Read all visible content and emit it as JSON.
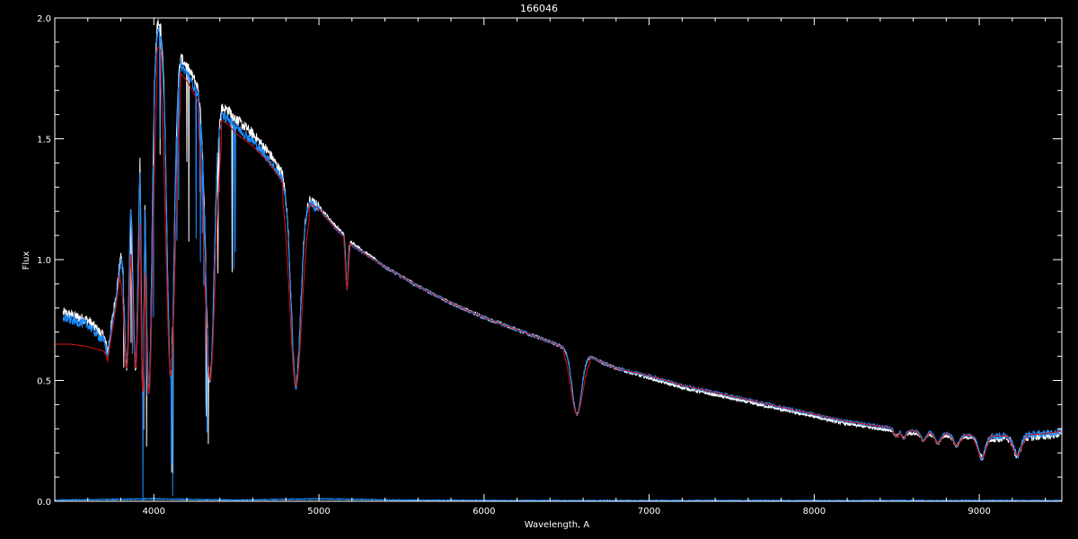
{
  "chart_data": {
    "type": "line",
    "title": "166046",
    "xlabel": "Wavelength, A",
    "ylabel": "Flux",
    "xlim": [
      3400,
      9500
    ],
    "ylim": [
      0,
      2.0
    ],
    "x_ticks": [
      4000,
      5000,
      6000,
      7000,
      8000,
      9000
    ],
    "x_tick_labels": [
      "4000",
      "5000",
      "6000",
      "7000",
      "8000",
      "9000"
    ],
    "y_ticks": [
      0.0,
      0.5,
      1.0,
      1.5,
      2.0
    ],
    "y_tick_labels": [
      "0.0",
      "0.5",
      "1.0",
      "1.5",
      "2.0"
    ],
    "grid": false,
    "background": "#000000",
    "foreground": "#ffffff",
    "series": [
      {
        "color": "#ffffff",
        "style": "observed-white",
        "x": [
          3450,
          3600,
          3700,
          3720,
          3780,
          3850,
          3900,
          3950,
          4000,
          4030,
          4080,
          4150,
          4200,
          4250,
          4300,
          4400,
          4450,
          4500,
          4600,
          4700,
          4800,
          4850,
          4900,
          5000,
          5100,
          5200,
          5400,
          5600,
          5800,
          6000,
          6200,
          6400,
          6500,
          6600,
          6700,
          6800,
          7000,
          7200,
          7400,
          7600,
          7800,
          8000,
          8200,
          8400,
          8600,
          8800,
          9000,
          9200,
          9400,
          9500
        ],
        "y": [
          0.78,
          0.75,
          0.68,
          0.62,
          0.9,
          1.35,
          1.62,
          1.78,
          1.95,
          1.98,
          1.88,
          1.85,
          1.8,
          1.74,
          1.65,
          1.63,
          1.62,
          1.58,
          1.52,
          1.44,
          1.33,
          1.28,
          1.26,
          1.22,
          1.14,
          1.07,
          0.97,
          0.89,
          0.82,
          0.76,
          0.71,
          0.66,
          0.63,
          0.61,
          0.58,
          0.55,
          0.51,
          0.47,
          0.44,
          0.41,
          0.38,
          0.35,
          0.32,
          0.3,
          0.28,
          0.27,
          0.26,
          0.26,
          0.27,
          0.28
        ]
      },
      {
        "color": "#1a8cff",
        "style": "observed-blue",
        "x": [
          3450,
          3600,
          3700,
          3720,
          3780,
          3850,
          3900,
          3950,
          4000,
          4030,
          4080,
          4150,
          4200,
          4250,
          4300,
          4400,
          4450,
          4500,
          4600,
          4700,
          4800,
          4850,
          4900,
          5000,
          5100,
          5200,
          5400,
          5600,
          5800,
          6000,
          6200,
          6400,
          6500,
          6600,
          6700,
          6800,
          7000,
          7200,
          7400,
          7600,
          7800,
          8000,
          8200,
          8400,
          8600,
          8800,
          9000,
          9200,
          9400,
          9500
        ],
        "y": [
          0.76,
          0.73,
          0.66,
          0.6,
          0.88,
          1.32,
          1.58,
          1.74,
          1.9,
          1.95,
          1.85,
          1.82,
          1.77,
          1.71,
          1.62,
          1.6,
          1.58,
          1.55,
          1.49,
          1.41,
          1.31,
          1.27,
          1.25,
          1.21,
          1.13,
          1.06,
          0.97,
          0.89,
          0.82,
          0.76,
          0.71,
          0.66,
          0.63,
          0.61,
          0.58,
          0.55,
          0.52,
          0.48,
          0.45,
          0.42,
          0.39,
          0.36,
          0.33,
          0.31,
          0.29,
          0.28,
          0.27,
          0.27,
          0.28,
          0.29
        ]
      },
      {
        "color": "#cc1111",
        "style": "model-red",
        "x": [
          3400,
          3500,
          3600,
          3700,
          3720,
          3780,
          3850,
          3900,
          3950,
          4000,
          4030,
          4080,
          4150,
          4200,
          4250,
          4300,
          4400,
          4450,
          4500,
          4600,
          4700,
          4800,
          4850,
          4900,
          5000,
          5100,
          5200,
          5400,
          5600,
          5800,
          6000,
          6200,
          6400,
          6500,
          6600,
          6700,
          6800,
          7000,
          7200,
          7400,
          7600,
          7800,
          8000,
          8200,
          8400,
          8600,
          8800,
          9000,
          9200,
          9400,
          9500
        ],
        "y": [
          0.65,
          0.65,
          0.64,
          0.62,
          0.58,
          0.85,
          1.28,
          1.55,
          1.7,
          1.85,
          1.88,
          1.8,
          1.78,
          1.74,
          1.68,
          1.6,
          1.58,
          1.56,
          1.52,
          1.47,
          1.4,
          1.3,
          1.26,
          1.25,
          1.21,
          1.13,
          1.06,
          0.97,
          0.89,
          0.82,
          0.76,
          0.71,
          0.66,
          0.63,
          0.61,
          0.58,
          0.55,
          0.52,
          0.48,
          0.45,
          0.42,
          0.39,
          0.36,
          0.33,
          0.31,
          0.29,
          0.28,
          0.27,
          0.27,
          0.28,
          0.29
        ]
      },
      {
        "color": "#1a8cff",
        "style": "error-blue",
        "x": [
          3400,
          4000,
          4500,
          5000,
          5500,
          6000,
          7000,
          8000,
          9000,
          9500
        ],
        "y": [
          0.005,
          0.01,
          0.005,
          0.01,
          0.005,
          0.003,
          0.003,
          0.003,
          0.003,
          0.003
        ]
      }
    ],
    "absorption_lines": [
      {
        "x": 3835,
        "depth_to": 0.55,
        "width": 20
      },
      {
        "x": 3889,
        "depth_to": 0.55,
        "width": 22
      },
      {
        "x": 3933,
        "depth_to": 0.52,
        "width": 14
      },
      {
        "x": 3970,
        "depth_to": 0.45,
        "width": 25
      },
      {
        "x": 4102,
        "depth_to": 0.52,
        "width": 30
      },
      {
        "x": 4340,
        "depth_to": 0.5,
        "width": 35
      },
      {
        "x": 4861,
        "depth_to": 0.48,
        "width": 40
      },
      {
        "x": 5170,
        "depth_to": 0.88,
        "width": 10
      },
      {
        "x": 6563,
        "depth_to": 0.36,
        "width": 40
      },
      {
        "x": 8498,
        "depth_to": 0.27,
        "width": 18
      },
      {
        "x": 8542,
        "depth_to": 0.26,
        "width": 18
      },
      {
        "x": 8662,
        "depth_to": 0.25,
        "width": 20
      },
      {
        "x": 8750,
        "depth_to": 0.24,
        "width": 22
      },
      {
        "x": 8863,
        "depth_to": 0.23,
        "width": 24
      },
      {
        "x": 9015,
        "depth_to": 0.18,
        "width": 28
      },
      {
        "x": 9229,
        "depth_to": 0.19,
        "width": 30
      }
    ]
  }
}
